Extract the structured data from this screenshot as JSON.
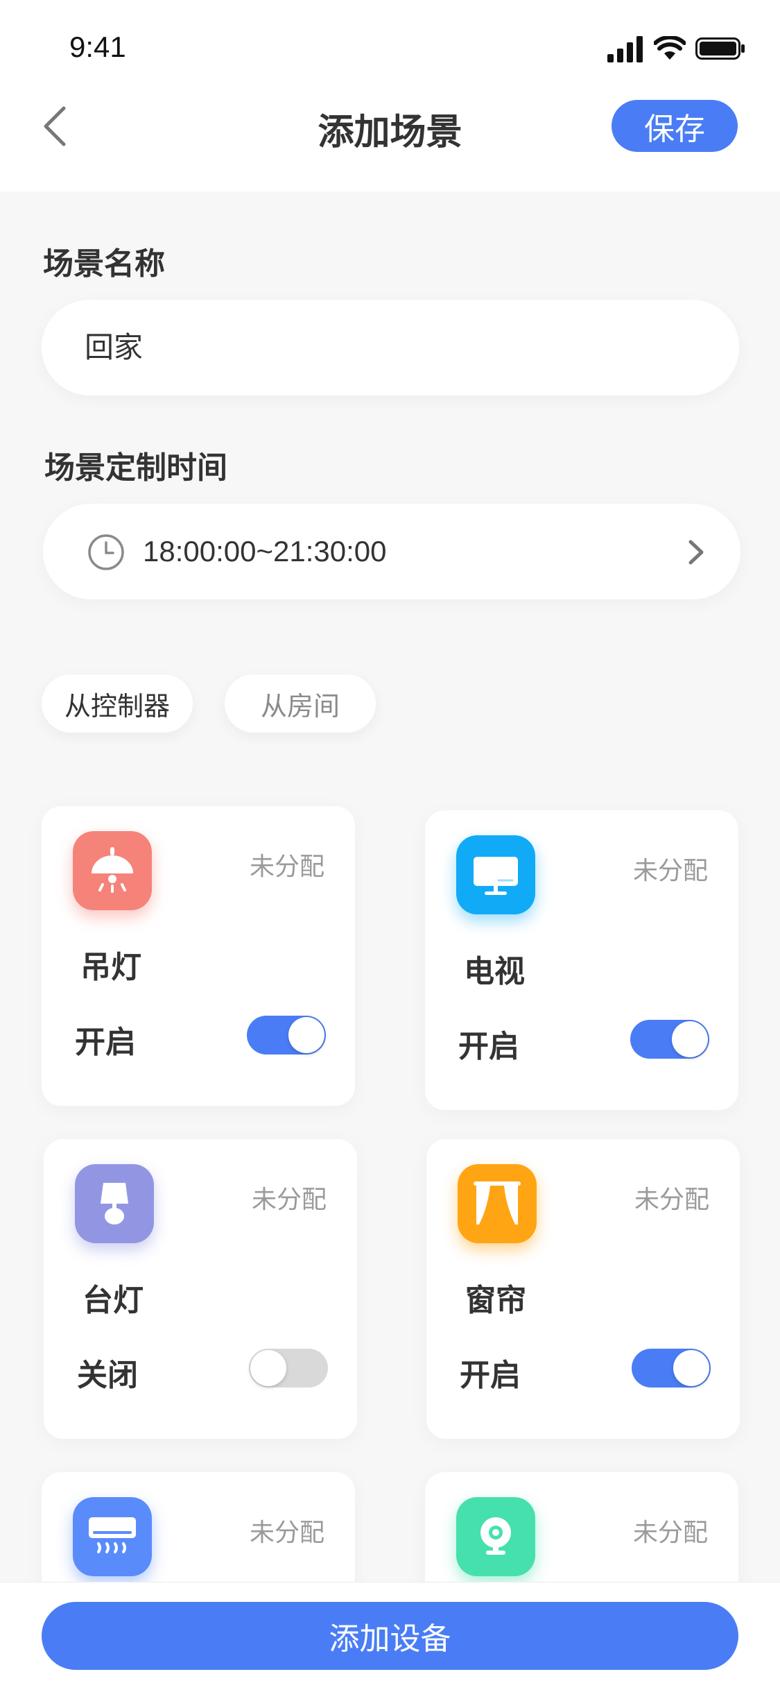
{
  "status_bar": {
    "time": "9:41"
  },
  "header": {
    "title": "添加场景",
    "save_label": "保存"
  },
  "scene_name": {
    "label": "场景名称",
    "value": "回家"
  },
  "scene_time": {
    "label": "场景定制时间",
    "value": "18:00:00~21:30:00"
  },
  "filters": [
    {
      "label": "从控制器",
      "active": true
    },
    {
      "label": "从房间",
      "active": false
    }
  ],
  "devices": [
    {
      "name": "吊灯",
      "status": "未分配",
      "state_label": "开启",
      "on": true,
      "icon": "pendant-lamp-icon",
      "color": "#f5837a"
    },
    {
      "name": "电视",
      "status": "未分配",
      "state_label": "开启",
      "on": true,
      "icon": "tv-icon",
      "color": "#11aaf7"
    },
    {
      "name": "台灯",
      "status": "未分配",
      "state_label": "关闭",
      "on": false,
      "icon": "desk-lamp-icon",
      "color": "#9296e2"
    },
    {
      "name": "窗帘",
      "status": "未分配",
      "state_label": "开启",
      "on": true,
      "icon": "curtain-icon",
      "color": "#ffa514"
    },
    {
      "name": "",
      "status": "未分配",
      "state_label": "",
      "on": true,
      "icon": "air-conditioner-icon",
      "color": "#5a8bfb"
    },
    {
      "name": "",
      "status": "未分配",
      "state_label": "",
      "on": true,
      "icon": "camera-icon",
      "color": "#46e0ae"
    }
  ],
  "bottom": {
    "add_device_label": "添加设备"
  },
  "colors": {
    "accent": "#4a7df5",
    "background": "#f7f7f7",
    "toggle_off": "#d9d9d9"
  }
}
